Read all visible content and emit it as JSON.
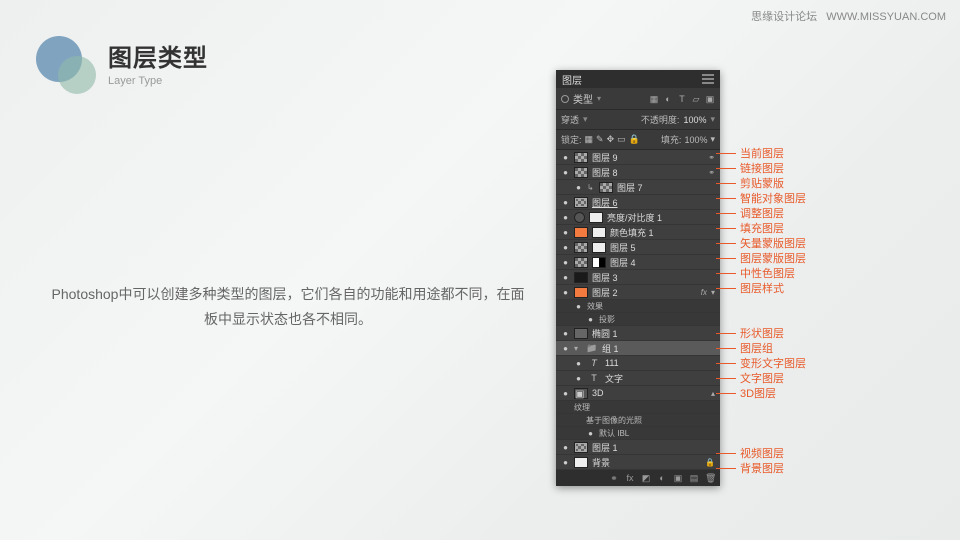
{
  "watermark": {
    "cn": "思缘设计论坛",
    "en": "WWW.MISSYUAN.COM"
  },
  "title": {
    "cn": "图层类型",
    "en": "Layer Type"
  },
  "description": "Photoshop中可以创建多种类型的图层，它们各自的功能和用途都不同，在面板中显示状态也各不相同。",
  "panel": {
    "tab": "图层",
    "filterLabel": "类型",
    "blend": "穿透",
    "opacityLabel": "不透明度:",
    "opacityVal": "100%",
    "lockLabel": "锁定:",
    "fillLabel": "填充:",
    "fillVal": "100%",
    "fxLabel": "效果",
    "shadowLabel": "投影",
    "texLabel": "纹理",
    "iblTitle": "基于图像的光照",
    "iblDefault": "默认 IBL"
  },
  "layers": [
    {
      "name": "图层 9",
      "thumb": "checker",
      "link": true
    },
    {
      "name": "图层 8",
      "thumb": "checker",
      "link": true
    },
    {
      "name": "图层 7",
      "thumb": "checker",
      "clip": true
    },
    {
      "name": "图层 6",
      "thumb": "checker",
      "smart": true
    },
    {
      "name": "亮度/对比度 1",
      "thumb": "adj",
      "adj": true
    },
    {
      "name": "颜色填充 1",
      "thumb": "orange",
      "mask": true
    },
    {
      "name": "图层 5",
      "thumb": "checker",
      "vmask": true
    },
    {
      "name": "图层 4",
      "thumb": "checker",
      "lmask": true
    },
    {
      "name": "图层 3",
      "thumb": "dark"
    },
    {
      "name": "图层 2",
      "thumb": "orange",
      "fx": true
    },
    {
      "name": "椭圆 1",
      "thumb": "shape",
      "shape": true
    },
    {
      "name": "组 1",
      "folder": true,
      "sel": true
    },
    {
      "name": "111",
      "thumb": "t",
      "warp": true
    },
    {
      "name": "文字",
      "thumb": "t"
    },
    {
      "name": "3D",
      "folder": true,
      "d3": true
    },
    {
      "name": "图层 1",
      "thumb": "checker",
      "video": true
    },
    {
      "name": "背景",
      "thumb": "white",
      "lock": true
    }
  ],
  "annotations": [
    {
      "txt": "当前图层",
      "y": 0
    },
    {
      "txt": "链接图层",
      "y": 1
    },
    {
      "txt": "剪贴蒙版",
      "y": 2
    },
    {
      "txt": "智能对象图层",
      "y": 3
    },
    {
      "txt": "调整图层",
      "y": 4
    },
    {
      "txt": "填充图层",
      "y": 5
    },
    {
      "txt": "矢量蒙版图层",
      "y": 6
    },
    {
      "txt": "图层蒙版图层",
      "y": 7
    },
    {
      "txt": "中性色图层",
      "y": 8
    },
    {
      "txt": "图层样式",
      "y": 9
    },
    {
      "txt": "形状图层",
      "y": 12
    },
    {
      "txt": "图层组",
      "y": 13
    },
    {
      "txt": "变形文字图层",
      "y": 14
    },
    {
      "txt": "文字图层",
      "y": 15
    },
    {
      "txt": "3D图层",
      "y": 16
    },
    {
      "txt": "视频图层",
      "y": 20
    },
    {
      "txt": "背景图层",
      "y": 21
    }
  ]
}
